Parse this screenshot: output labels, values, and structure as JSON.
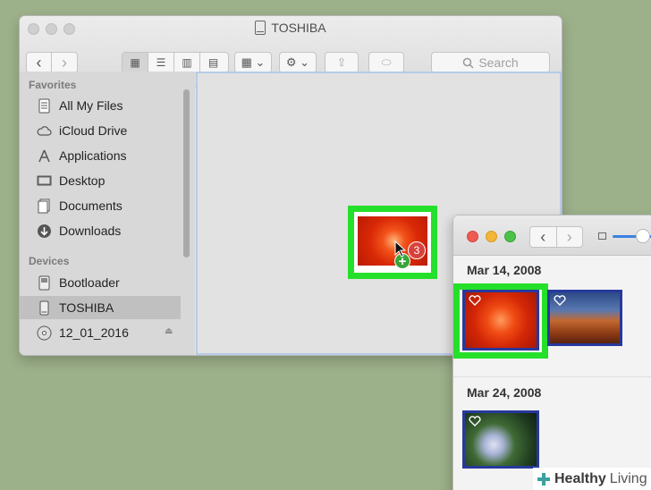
{
  "finder": {
    "title": "TOSHIBA",
    "toolbar": {
      "back": "‹",
      "forward": "›",
      "view_icons": "▦",
      "view_list": "☰",
      "view_columns": "▥",
      "view_coverflow": "▤",
      "arrange": "▦ ⌄",
      "action": "⚙ ⌄",
      "share": "⇪",
      "tag": "⬭",
      "search_placeholder": "Search"
    },
    "sidebar": {
      "favorites_heading": "Favorites",
      "favorites": [
        {
          "label": "All My Files",
          "icon": "all-files-icon"
        },
        {
          "label": "iCloud Drive",
          "icon": "cloud-icon"
        },
        {
          "label": "Applications",
          "icon": "applications-icon"
        },
        {
          "label": "Desktop",
          "icon": "desktop-icon"
        },
        {
          "label": "Documents",
          "icon": "documents-icon"
        },
        {
          "label": "Downloads",
          "icon": "downloads-icon"
        }
      ],
      "devices_heading": "Devices",
      "devices": [
        {
          "label": "Bootloader",
          "icon": "drive-icon"
        },
        {
          "label": "TOSHIBA",
          "icon": "drive-icon",
          "selected": true
        },
        {
          "label": "12_01_2016",
          "icon": "disc-icon",
          "eject": "⏏"
        }
      ]
    }
  },
  "drag": {
    "count_badge": "3",
    "copy_badge": "+"
  },
  "photos": {
    "groups": [
      {
        "date": "Mar 14, 2008",
        "photos": [
          "flower-red",
          "desert-canyon"
        ]
      },
      {
        "date": "Mar 24, 2008",
        "photos": [
          "hydrangea"
        ]
      }
    ],
    "nav_back": "‹",
    "nav_forward": "›",
    "zoom_level": 0.55
  },
  "watermark": {
    "brand_bold": "Healthy",
    "brand_light": "Living"
  },
  "colors": {
    "highlight": "#25e02a",
    "selection_border": "#27399c",
    "background": "#9cb08a"
  }
}
